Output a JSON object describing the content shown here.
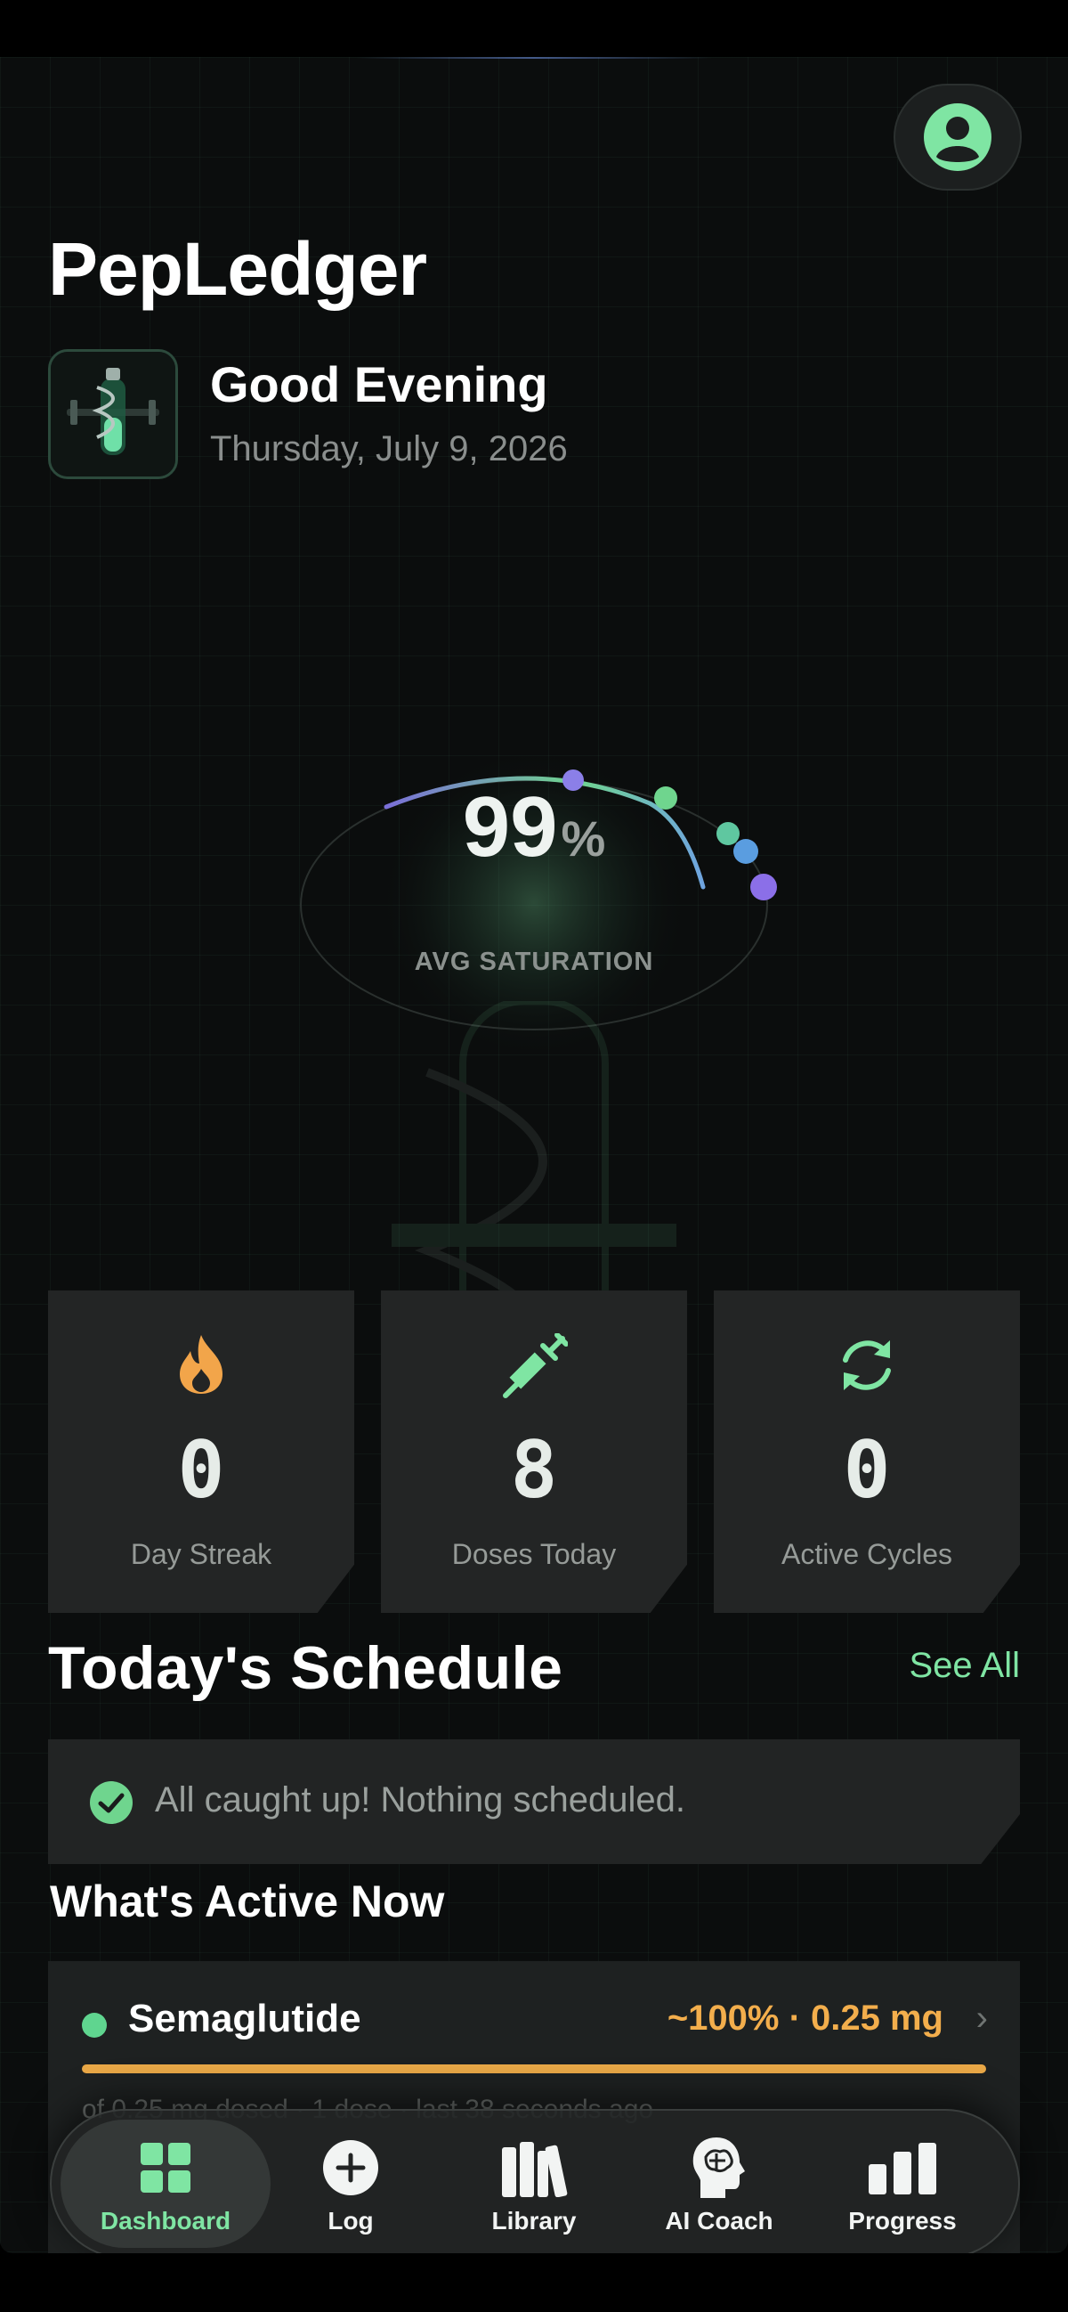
{
  "header": {
    "app_title": "PepLedger",
    "greeting": "Good Evening",
    "date": "Thursday, July 9, 2026",
    "profile_icon": "user-circle-icon"
  },
  "saturation": {
    "value": "99",
    "unit": "%",
    "label": "AVG SATURATION",
    "marker_colors": [
      "#8b7fe8",
      "#6fd58e",
      "#5fc7a0",
      "#5a9de0",
      "#8b6fe8"
    ]
  },
  "stats": [
    {
      "icon": "flame-icon",
      "value": "0",
      "label": "Day Streak",
      "color": "#f2a54a"
    },
    {
      "icon": "syringe-icon",
      "value": "8",
      "label": "Doses Today",
      "color": "#7fe5a3"
    },
    {
      "icon": "refresh-icon",
      "value": "0",
      "label": "Active Cycles",
      "color": "#7fe5a3"
    }
  ],
  "schedule": {
    "title": "Today's Schedule",
    "see_all": "See All",
    "empty_text": "All caught up! Nothing scheduled."
  },
  "active": {
    "title": "What's Active Now",
    "items": [
      {
        "name": "Semaglutide",
        "meta": "~100% · 0.25 mg",
        "level": 1.0,
        "detail": "of 0.25 mg dosed · 1 dose · last 38 seconds ago"
      }
    ]
  },
  "tabs": [
    {
      "label": "Dashboard",
      "icon": "grid-icon",
      "active": true
    },
    {
      "label": "Log",
      "icon": "plus-circle-icon",
      "active": false
    },
    {
      "label": "Library",
      "icon": "books-icon",
      "active": false
    },
    {
      "label": "AI Coach",
      "icon": "brain-head-icon",
      "active": false
    },
    {
      "label": "Progress",
      "icon": "bar-chart-icon",
      "active": false
    }
  ],
  "colors": {
    "accent": "#7fe5a3",
    "warning": "#f3ae4c",
    "background": "#0b0d0d",
    "card": "#232525"
  }
}
